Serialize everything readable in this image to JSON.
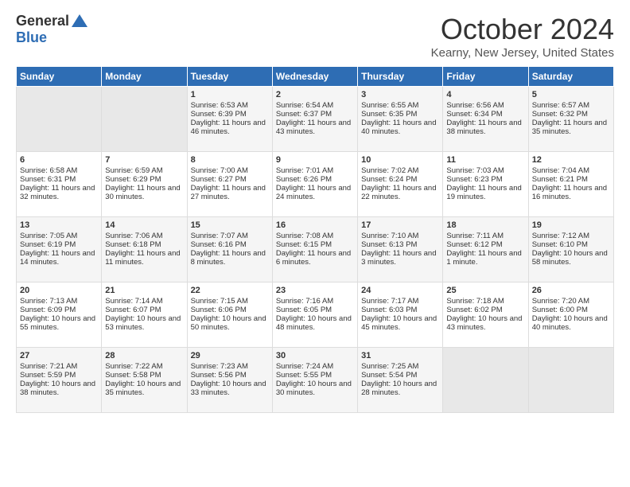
{
  "logo": {
    "general": "General",
    "blue": "Blue"
  },
  "header": {
    "month": "October 2024",
    "location": "Kearny, New Jersey, United States"
  },
  "days_of_week": [
    "Sunday",
    "Monday",
    "Tuesday",
    "Wednesday",
    "Thursday",
    "Friday",
    "Saturday"
  ],
  "weeks": [
    [
      {
        "day": "",
        "sunrise": "",
        "sunset": "",
        "daylight": ""
      },
      {
        "day": "",
        "sunrise": "",
        "sunset": "",
        "daylight": ""
      },
      {
        "day": "1",
        "sunrise": "Sunrise: 6:53 AM",
        "sunset": "Sunset: 6:39 PM",
        "daylight": "Daylight: 11 hours and 46 minutes."
      },
      {
        "day": "2",
        "sunrise": "Sunrise: 6:54 AM",
        "sunset": "Sunset: 6:37 PM",
        "daylight": "Daylight: 11 hours and 43 minutes."
      },
      {
        "day": "3",
        "sunrise": "Sunrise: 6:55 AM",
        "sunset": "Sunset: 6:35 PM",
        "daylight": "Daylight: 11 hours and 40 minutes."
      },
      {
        "day": "4",
        "sunrise": "Sunrise: 6:56 AM",
        "sunset": "Sunset: 6:34 PM",
        "daylight": "Daylight: 11 hours and 38 minutes."
      },
      {
        "day": "5",
        "sunrise": "Sunrise: 6:57 AM",
        "sunset": "Sunset: 6:32 PM",
        "daylight": "Daylight: 11 hours and 35 minutes."
      }
    ],
    [
      {
        "day": "6",
        "sunrise": "Sunrise: 6:58 AM",
        "sunset": "Sunset: 6:31 PM",
        "daylight": "Daylight: 11 hours and 32 minutes."
      },
      {
        "day": "7",
        "sunrise": "Sunrise: 6:59 AM",
        "sunset": "Sunset: 6:29 PM",
        "daylight": "Daylight: 11 hours and 30 minutes."
      },
      {
        "day": "8",
        "sunrise": "Sunrise: 7:00 AM",
        "sunset": "Sunset: 6:27 PM",
        "daylight": "Daylight: 11 hours and 27 minutes."
      },
      {
        "day": "9",
        "sunrise": "Sunrise: 7:01 AM",
        "sunset": "Sunset: 6:26 PM",
        "daylight": "Daylight: 11 hours and 24 minutes."
      },
      {
        "day": "10",
        "sunrise": "Sunrise: 7:02 AM",
        "sunset": "Sunset: 6:24 PM",
        "daylight": "Daylight: 11 hours and 22 minutes."
      },
      {
        "day": "11",
        "sunrise": "Sunrise: 7:03 AM",
        "sunset": "Sunset: 6:23 PM",
        "daylight": "Daylight: 11 hours and 19 minutes."
      },
      {
        "day": "12",
        "sunrise": "Sunrise: 7:04 AM",
        "sunset": "Sunset: 6:21 PM",
        "daylight": "Daylight: 11 hours and 16 minutes."
      }
    ],
    [
      {
        "day": "13",
        "sunrise": "Sunrise: 7:05 AM",
        "sunset": "Sunset: 6:19 PM",
        "daylight": "Daylight: 11 hours and 14 minutes."
      },
      {
        "day": "14",
        "sunrise": "Sunrise: 7:06 AM",
        "sunset": "Sunset: 6:18 PM",
        "daylight": "Daylight: 11 hours and 11 minutes."
      },
      {
        "day": "15",
        "sunrise": "Sunrise: 7:07 AM",
        "sunset": "Sunset: 6:16 PM",
        "daylight": "Daylight: 11 hours and 8 minutes."
      },
      {
        "day": "16",
        "sunrise": "Sunrise: 7:08 AM",
        "sunset": "Sunset: 6:15 PM",
        "daylight": "Daylight: 11 hours and 6 minutes."
      },
      {
        "day": "17",
        "sunrise": "Sunrise: 7:10 AM",
        "sunset": "Sunset: 6:13 PM",
        "daylight": "Daylight: 11 hours and 3 minutes."
      },
      {
        "day": "18",
        "sunrise": "Sunrise: 7:11 AM",
        "sunset": "Sunset: 6:12 PM",
        "daylight": "Daylight: 11 hours and 1 minute."
      },
      {
        "day": "19",
        "sunrise": "Sunrise: 7:12 AM",
        "sunset": "Sunset: 6:10 PM",
        "daylight": "Daylight: 10 hours and 58 minutes."
      }
    ],
    [
      {
        "day": "20",
        "sunrise": "Sunrise: 7:13 AM",
        "sunset": "Sunset: 6:09 PM",
        "daylight": "Daylight: 10 hours and 55 minutes."
      },
      {
        "day": "21",
        "sunrise": "Sunrise: 7:14 AM",
        "sunset": "Sunset: 6:07 PM",
        "daylight": "Daylight: 10 hours and 53 minutes."
      },
      {
        "day": "22",
        "sunrise": "Sunrise: 7:15 AM",
        "sunset": "Sunset: 6:06 PM",
        "daylight": "Daylight: 10 hours and 50 minutes."
      },
      {
        "day": "23",
        "sunrise": "Sunrise: 7:16 AM",
        "sunset": "Sunset: 6:05 PM",
        "daylight": "Daylight: 10 hours and 48 minutes."
      },
      {
        "day": "24",
        "sunrise": "Sunrise: 7:17 AM",
        "sunset": "Sunset: 6:03 PM",
        "daylight": "Daylight: 10 hours and 45 minutes."
      },
      {
        "day": "25",
        "sunrise": "Sunrise: 7:18 AM",
        "sunset": "Sunset: 6:02 PM",
        "daylight": "Daylight: 10 hours and 43 minutes."
      },
      {
        "day": "26",
        "sunrise": "Sunrise: 7:20 AM",
        "sunset": "Sunset: 6:00 PM",
        "daylight": "Daylight: 10 hours and 40 minutes."
      }
    ],
    [
      {
        "day": "27",
        "sunrise": "Sunrise: 7:21 AM",
        "sunset": "Sunset: 5:59 PM",
        "daylight": "Daylight: 10 hours and 38 minutes."
      },
      {
        "day": "28",
        "sunrise": "Sunrise: 7:22 AM",
        "sunset": "Sunset: 5:58 PM",
        "daylight": "Daylight: 10 hours and 35 minutes."
      },
      {
        "day": "29",
        "sunrise": "Sunrise: 7:23 AM",
        "sunset": "Sunset: 5:56 PM",
        "daylight": "Daylight: 10 hours and 33 minutes."
      },
      {
        "day": "30",
        "sunrise": "Sunrise: 7:24 AM",
        "sunset": "Sunset: 5:55 PM",
        "daylight": "Daylight: 10 hours and 30 minutes."
      },
      {
        "day": "31",
        "sunrise": "Sunrise: 7:25 AM",
        "sunset": "Sunset: 5:54 PM",
        "daylight": "Daylight: 10 hours and 28 minutes."
      },
      {
        "day": "",
        "sunrise": "",
        "sunset": "",
        "daylight": ""
      },
      {
        "day": "",
        "sunrise": "",
        "sunset": "",
        "daylight": ""
      }
    ]
  ]
}
